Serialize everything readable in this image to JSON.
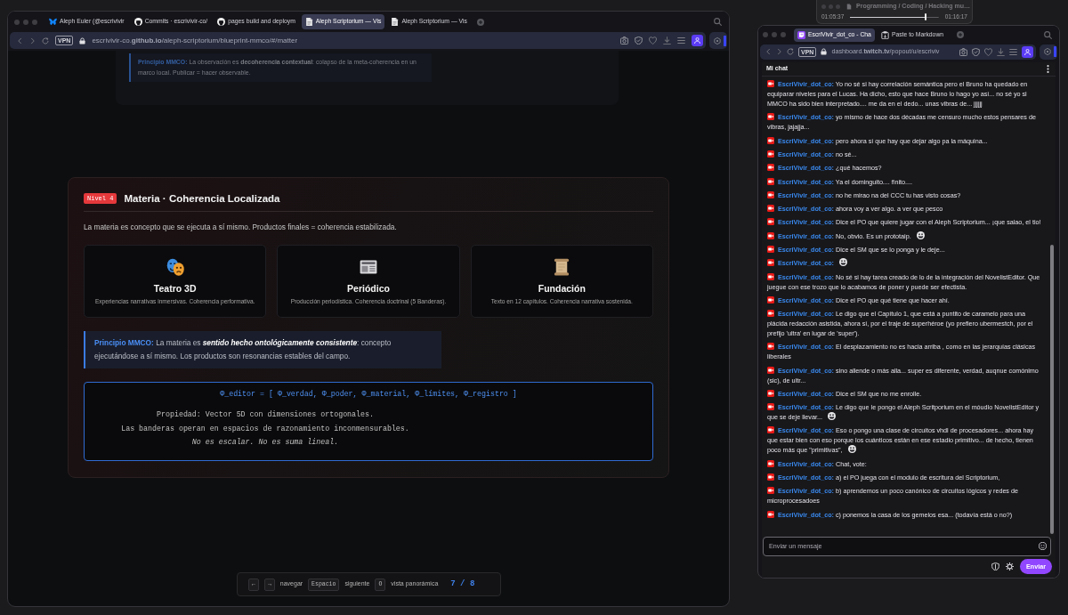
{
  "browser": {
    "tabs": [
      {
        "label": "Aleph Euler (@escrivivir",
        "kind": "butterfly",
        "selected": false
      },
      {
        "label": "Commits · escrivivir-co/",
        "kind": "cat",
        "selected": false
      },
      {
        "label": "pages build and deploym",
        "kind": "cat",
        "selected": false
      },
      {
        "label": "Aleph Scriptorium — Vis",
        "kind": "page",
        "selected": true
      },
      {
        "label": "Aleph Scriptorium — Vis",
        "kind": "page",
        "selected": false
      }
    ],
    "vpn_badge": "VPN",
    "url": "escrivivir-co.**github.io**/aleph-scriptorium/blueprint-mmco/#/matter"
  },
  "previous_slide": {
    "dimmed": true,
    "principle": {
      "label": "Principio MMCO:",
      "text": "La observación es **decoherencia contextual**: colapso de la meta-coherencia en un marco local. Publicar = hacer observable."
    }
  },
  "slide": {
    "level_badge": "Nivel 4",
    "title": "Materia · Coherencia Localizada",
    "intro": "La materia es concepto que se ejecuta a sí mismo. Productos finales = coherencia estabilizada.",
    "products": [
      {
        "kind": "masks",
        "title": "Teatro 3D",
        "description": "Experiencias narrativas inmersivas. Coherencia performativa."
      },
      {
        "kind": "newspaper",
        "title": "Periódico",
        "description": "Producción periodística. Coherencia doctrinal (5 Banderas)."
      },
      {
        "kind": "scroll",
        "title": "Fundación",
        "description": "Texto en 12 capítulos. Coherencia narrativa sostenida."
      }
    ],
    "principle": {
      "label": "Principio MMCO:",
      "text": "La materia es *sentido hecho ontológicamente consistente*: concepto ejecutándose a sí mismo. Los productos son resonancias estables del campo."
    },
    "formula": {
      "equation": "Φ_editor = [ Φ_verdad, Φ_poder, Φ_material, Φ_límites, Φ_registro ]",
      "lines": [
        {
          "kind": "plain",
          "text": "Propiedad: Vector 5D con dimensiones ortogonales."
        },
        {
          "kind": "plain",
          "text": "Las banderas operan en espacios de razonamiento inconmensurables."
        },
        {
          "kind": "emphasis",
          "text": "No es escalar. No es suma lineal."
        }
      ]
    }
  },
  "navigation_hint": {
    "items": [
      {
        "kind": "key",
        "text": "←"
      },
      {
        "kind": "key",
        "text": "→"
      },
      {
        "kind": "label",
        "text": "navegar"
      },
      {
        "kind": "key",
        "text": "Espacio"
      },
      {
        "kind": "label",
        "text": "siguiente"
      },
      {
        "kind": "key",
        "text": "O"
      },
      {
        "kind": "label",
        "text": "vista panorámica"
      }
    ],
    "counter": "7 / 8"
  },
  "media_player": {
    "title": "Programming / Coding / Hacking mu…",
    "elapsed": "01:05:37",
    "level": 0.85,
    "total": "01:16:17"
  },
  "chat_browser": {
    "tabs": [
      {
        "label": "EscriVivir_dot_co - Cha",
        "kind": "bubble",
        "selected": true
      },
      {
        "label": "Paste to Markdown",
        "kind": "clipboard",
        "selected": false
      }
    ],
    "vpn_badge": "VPN",
    "url": "dashboard.**twitch.tv**/popout/u/escriviv",
    "header": "Mi chat",
    "messages": [
      {
        "user": "EscriVivir_dot_co:",
        "text": "Yo no sé si hay correlación semántica pero el Bruno ha quedado en equiparar niveles para el Lucas. Ha dicho, esto que hace Bruno lo hago yo así... no sé yo si MMCO ha sido bien interpretado.... me da en el dedo... unas vibras de... jjjjjj",
        "emote": false
      },
      {
        "user": "EscriVivir_dot_co:",
        "text": "yo mismo de hace dos décadas me censuro mucho estos pensares de vibras, jajajja...",
        "emote": false
      },
      {
        "user": "EscriVivir_dot_co:",
        "text": "pero ahora sí que hay que dejar algo pa la máquina...",
        "emote": false
      },
      {
        "user": "EscriVivir_dot_co:",
        "text": "no sé...",
        "emote": false
      },
      {
        "user": "EscriVivir_dot_co:",
        "text": "¿qué hacemos?",
        "emote": false
      },
      {
        "user": "EscriVivir_dot_co:",
        "text": "Ya el dominguito.... finito....",
        "emote": false
      },
      {
        "user": "EscriVivir_dot_co:",
        "text": "no he mirao na del CCC tu has visto cosas?",
        "emote": false
      },
      {
        "user": "EscriVivir_dot_co:",
        "text": "ahora voy a ver algo. a ver que pesco",
        "emote": false
      },
      {
        "user": "EscriVivir_dot_co:",
        "text": "Dice el PO que quiere jugar con el Aleph Scriptorium... ¡que salao, el tio!",
        "emote": false
      },
      {
        "user": "EscriVivir_dot_co:",
        "text": "No, obvio. Es un prototaip.",
        "emote": true
      },
      {
        "user": "EscriVivir_dot_co:",
        "text": "Dice el SM que se lo ponga y le deje...",
        "emote": false
      },
      {
        "user": "EscriVivir_dot_co:",
        "emote": true
      },
      {
        "user": "EscriVivir_dot_co:",
        "text": "No sé si hay tarea creado de lo de la integración del NovelistEditor. Que juegue con ese trozo que lo acabamos de poner y puede ser efectista.",
        "emote": false
      },
      {
        "user": "EscriVivir_dot_co:",
        "text": "Dice el PO que qué tiene que hacer ahí.",
        "emote": false
      },
      {
        "user": "EscriVivir_dot_co:",
        "text": "Le digo que el Capítulo 1, que está a puntito de caramelo para una plácida redacción asistida, ahora sí, por el traje de superhéroe (yo prefiero ubermestch, por el prefijo 'ultra' en lugar de 'super').",
        "emote": false
      },
      {
        "user": "EscriVivir_dot_co:",
        "text": "El desplazamiento no es hacia arriba , como en las jerarquías clásicas liberales",
        "emote": false
      },
      {
        "user": "EscriVivir_dot_co:",
        "text": "sino allende o más alla... super es diferente, verdad, auqnue comónimo (sic), de ultr...",
        "emote": false
      },
      {
        "user": "EscriVivir_dot_co:",
        "text": "Dice el SM que no me enrolle.",
        "emote": false
      },
      {
        "user": "EscriVivir_dot_co:",
        "text": "Le digo que le pongo el Aleph Scritporium en el móudlo NovelistEditor y que se deje llevar...",
        "emote": true
      },
      {
        "user": "EscriVivir_dot_co:",
        "text": "Eso o pongo una clase de circuitos vhdl de procesadores... ahora hay que estar bien con eso porque los cuánticos están en ese estadio primitivo... de hecho, tienen poco más que \"primitivas\",",
        "emote": true
      },
      {
        "user": "EscriVivir_dot_co:",
        "text": "Chat, vote:",
        "emote": false
      },
      {
        "user": "EscriVivir_dot_co:",
        "text": "a) el PO juega con el modulo de escritura del Scriptorium,",
        "emote": false
      },
      {
        "user": "EscriVivir_dot_co:",
        "text": "b) aprendemos un poco canónico de circuitos lógicos y redes de microprocesadoes",
        "emote": false
      },
      {
        "user": "EscriVivir_dot_co:",
        "text": "c) ponemos la casa de los gemelos esa... (todavía está o no?)",
        "emote": false
      }
    ],
    "input": {
      "placeholder": "Enviar un mensaje"
    },
    "send_button": "Enviar"
  }
}
